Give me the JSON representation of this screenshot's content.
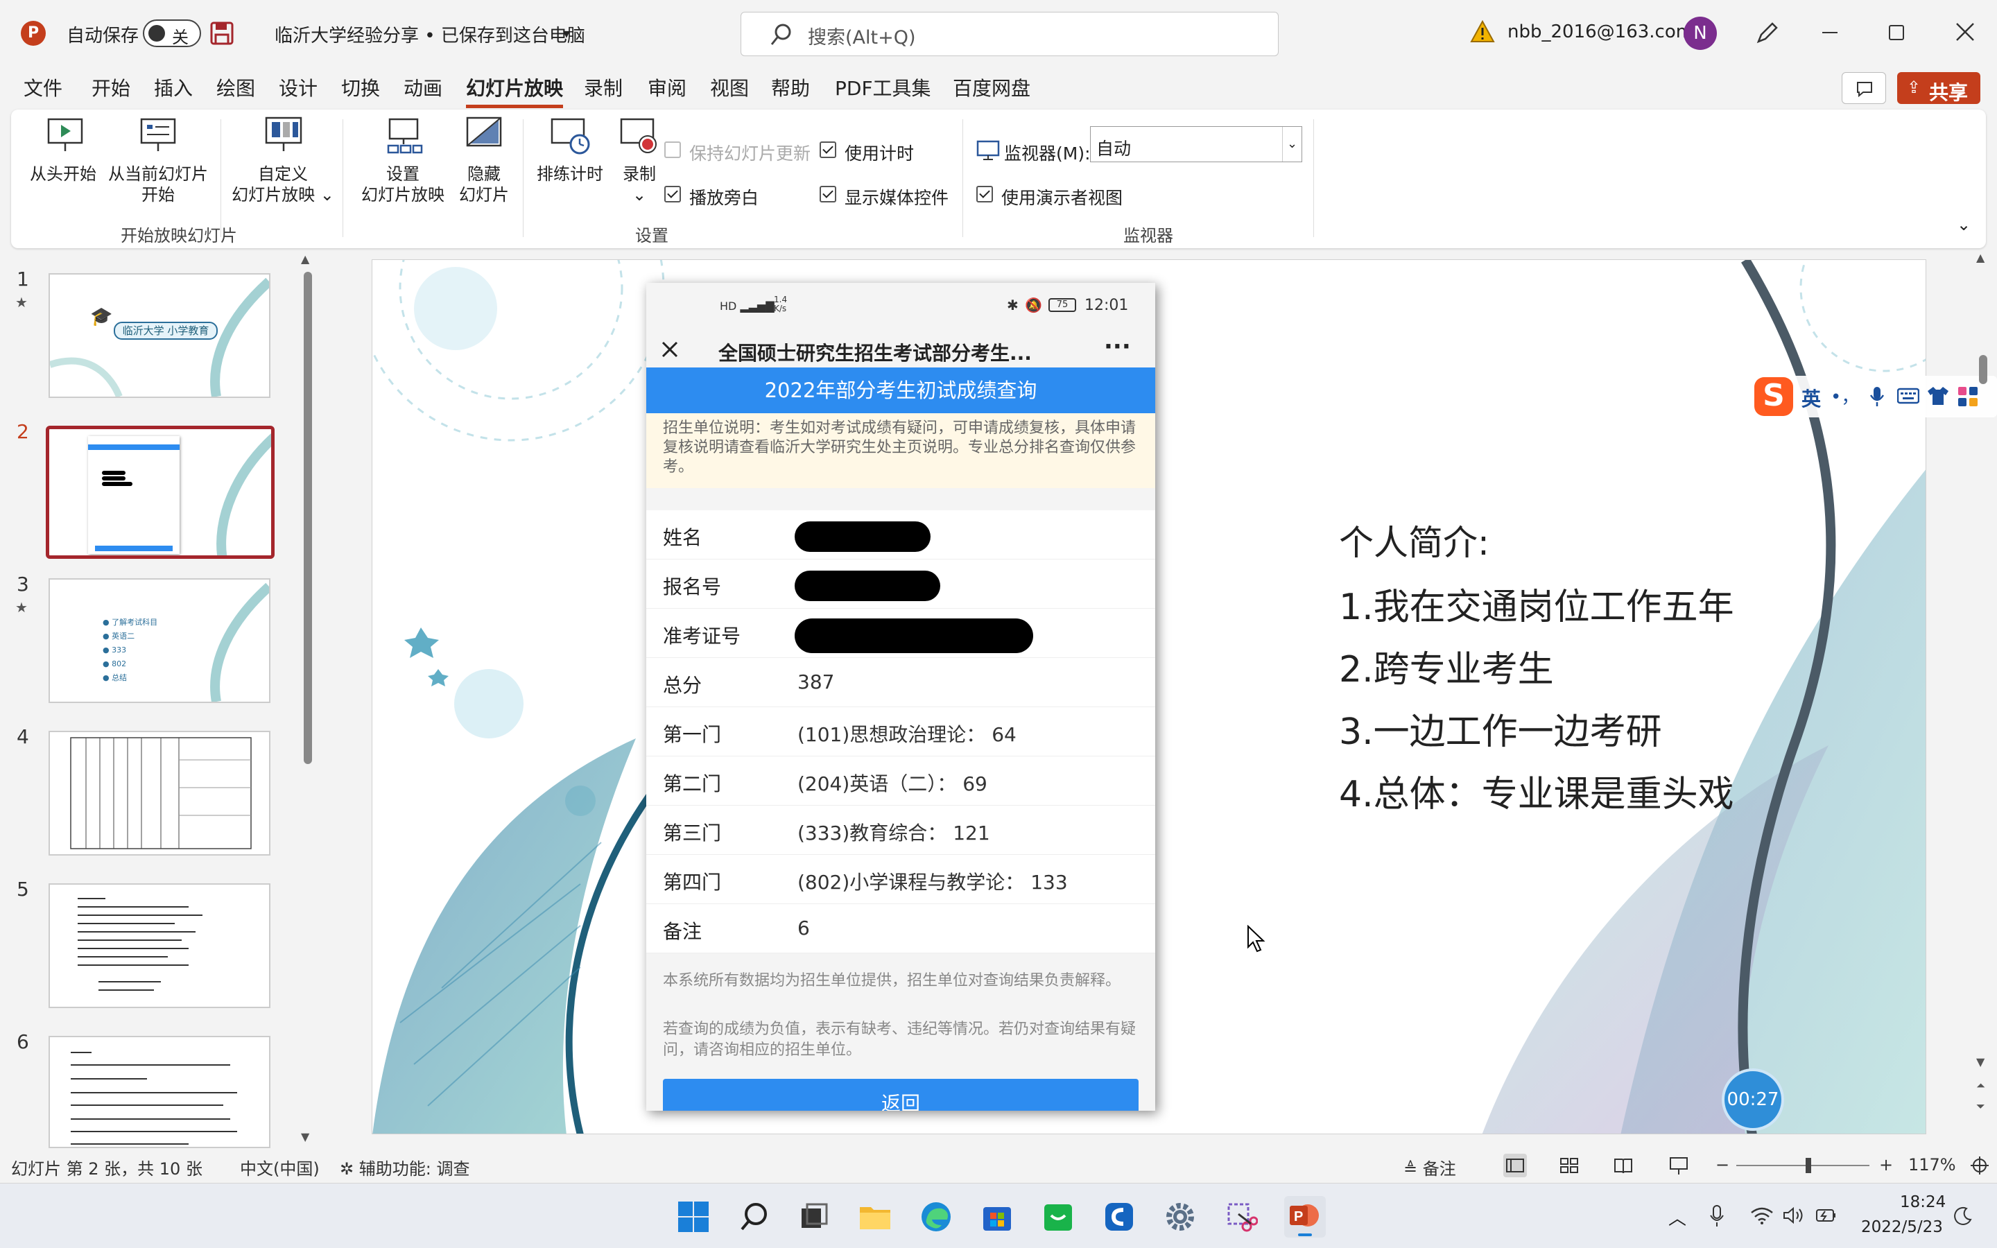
{
  "titlebar": {
    "autosave_label": "自动保存",
    "autosave_state": "关",
    "doc_title": "临沂大学经验分享 • 已保存到这台电脑",
    "search_placeholder": "搜索(Alt+Q)",
    "account": "nbb_2016@163.com",
    "avatar_letter": "N"
  },
  "tabs": [
    "文件",
    "开始",
    "插入",
    "绘图",
    "设计",
    "切换",
    "动画",
    "幻灯片放映",
    "录制",
    "审阅",
    "视图",
    "帮助",
    "PDF工具集",
    "百度网盘"
  ],
  "active_tab": "幻灯片放映",
  "share_label": "共享",
  "ribbon": {
    "from_start": "从头开始",
    "from_current_1": "从当前幻灯片",
    "from_current_2": "开始",
    "custom_1": "自定义",
    "custom_2": "幻灯片放映 ⌄",
    "group_start": "开始放映幻灯片",
    "setup_1": "设置",
    "setup_2": "幻灯片放映",
    "hide_1": "隐藏",
    "hide_2": "幻灯片",
    "rehearse": "排练计时",
    "record": "录制",
    "keep_updated": "保持幻灯片更新",
    "play_narration": "播放旁白",
    "use_timings": "使用计时",
    "show_media": "显示媒体控件",
    "group_setup": "设置",
    "monitor_label": "监视器(M):",
    "monitor_value": "自动",
    "presenter_view": "使用演示者视图",
    "group_monitor": "监视器"
  },
  "thumbnails": [
    {
      "num": "1",
      "star": true,
      "title": "临沂大学 小学教育"
    },
    {
      "num": "2",
      "star": false
    },
    {
      "num": "3",
      "star": true,
      "items": [
        "了解考试科目",
        "英语二",
        "333",
        "802",
        "总结"
      ]
    },
    {
      "num": "4",
      "star": false
    },
    {
      "num": "5",
      "star": false
    },
    {
      "num": "6",
      "star": false
    }
  ],
  "phone": {
    "time": "12:01",
    "battery": "75",
    "net": "1.4 K/s",
    "header_title": "全国硕士研究生招生考试部分考生...",
    "banner": "2022年部分考生初试成绩查询",
    "notice": "招生单位说明：考生如对考试成绩有疑问，可申请成绩复核，具体申请复核说明请查看临沂大学研究生处主页说明。专业总分排名查询仅供参考。",
    "rows": [
      {
        "k": "姓名",
        "v": ""
      },
      {
        "k": "报名号",
        "v": ""
      },
      {
        "k": "准考证号",
        "v": ""
      },
      {
        "k": "总分",
        "v": "387"
      },
      {
        "k": "第一门",
        "v": "(101)思想政治理论：  64"
      },
      {
        "k": "第二门",
        "v": "(204)英语（二）：  69"
      },
      {
        "k": "第三门",
        "v": "(333)教育综合：  121"
      },
      {
        "k": "第四门",
        "v": "(802)小学课程与教学论：  133"
      },
      {
        "k": "备注",
        "v": "6"
      }
    ],
    "footer1": "本系统所有数据均为招生单位提供，招生单位对查询结果负责解释。",
    "footer2": "若查询的成绩为负值，表示有缺考、违纪等情况。若仍对查询结果有疑问，请咨询相应的招生单位。",
    "back_button": "返回"
  },
  "slide_text": {
    "heading": "个人简介:",
    "l1": "1.我在交通岗位工作五年",
    "l2": "2.跨专业考生",
    "l3": "3.一边工作一边考研",
    "l4": "4.总体：专业课是重头戏"
  },
  "timer": "00:27",
  "ime": {
    "lang": "英",
    "punct": "•，"
  },
  "statusbar": {
    "slide_info": "幻灯片 第 2 张，共 10 张",
    "language": "中文(中国)",
    "accessibility": "辅助功能: 调查",
    "notes": "备注",
    "zoom": "117%"
  },
  "taskbar": {
    "time": "18:24",
    "date": "2022/5/23"
  },
  "colors": {
    "accent": "#c43e1c",
    "banner": "#2d8cf0",
    "selected_border": "#a4262c"
  }
}
